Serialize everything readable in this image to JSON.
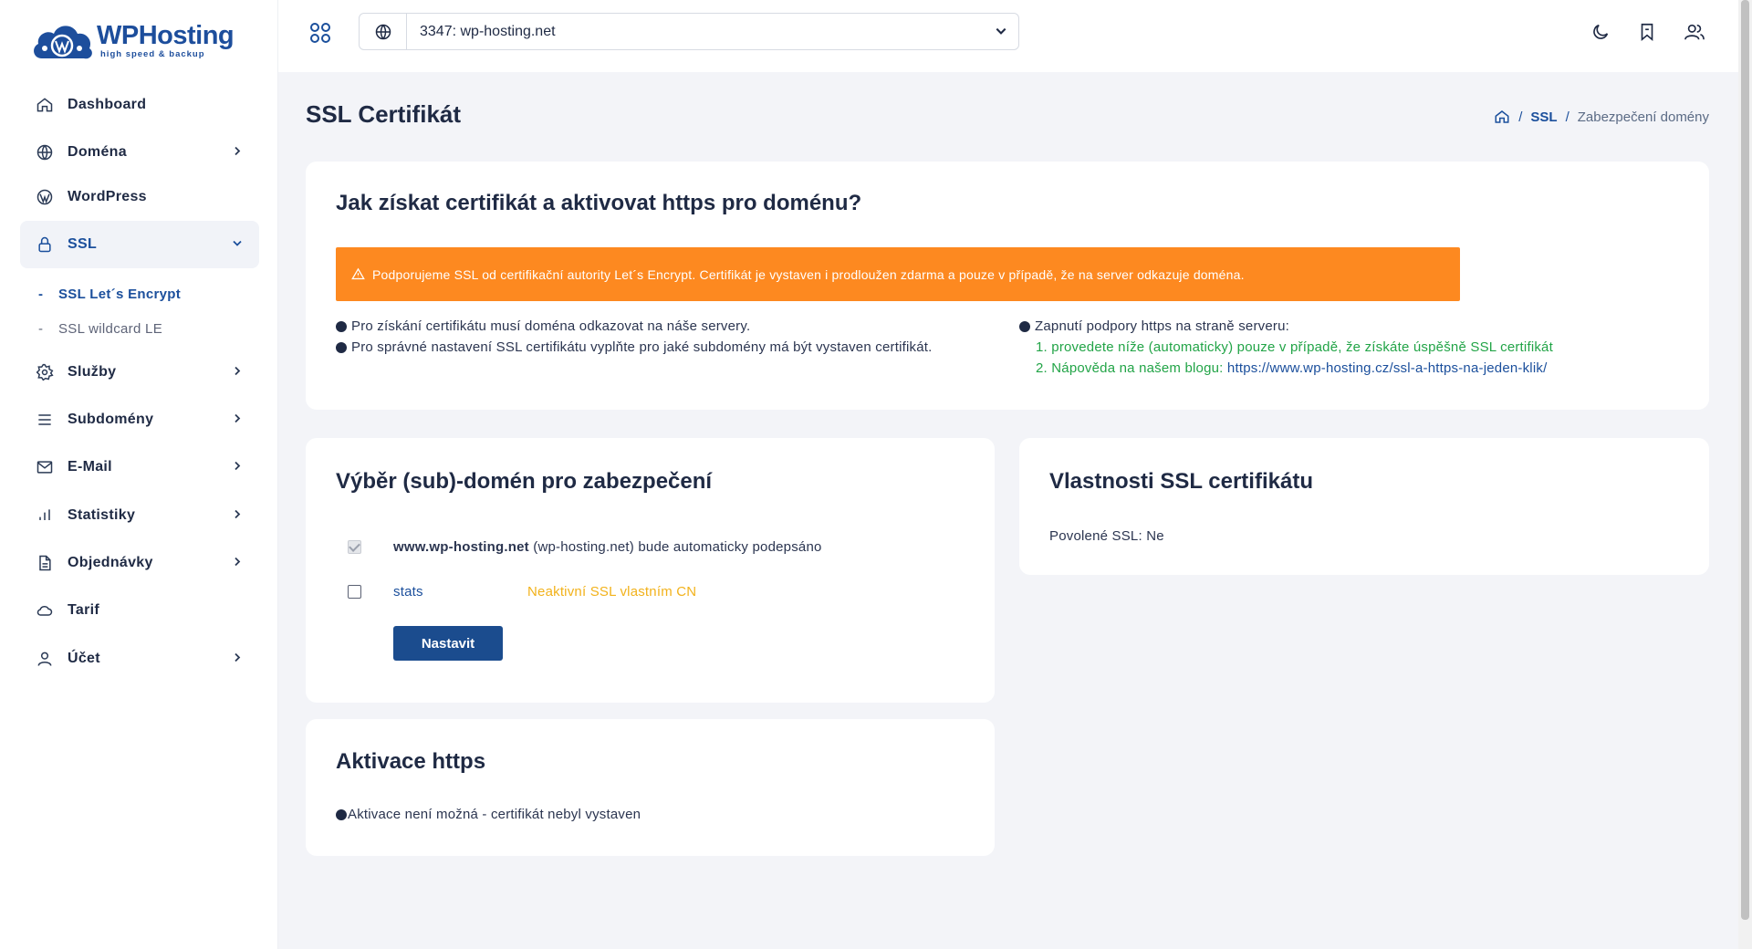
{
  "brand": {
    "name": "WPHosting",
    "tagline": "high speed & backup"
  },
  "sidebar": {
    "items": [
      {
        "label": "Dashboard",
        "icon": "home-icon"
      },
      {
        "label": "Doména",
        "icon": "globe-icon"
      },
      {
        "label": "WordPress",
        "icon": "wordpress-icon"
      },
      {
        "label": "SSL",
        "icon": "lock-icon"
      },
      {
        "label": "Služby",
        "icon": "gear-icon"
      },
      {
        "label": "Subdomény",
        "icon": "menu-lines-icon"
      },
      {
        "label": "E-Mail",
        "icon": "mail-icon"
      },
      {
        "label": "Statistiky",
        "icon": "bar-chart-icon"
      },
      {
        "label": "Objednávky",
        "icon": "document-icon"
      },
      {
        "label": "Tarif",
        "icon": "cloud-icon"
      },
      {
        "label": "Účet",
        "icon": "user-icon"
      }
    ],
    "ssl_sub": [
      {
        "label": "SSL Let´s Encrypt"
      },
      {
        "label": "SSL wildcard LE"
      }
    ]
  },
  "topbar": {
    "domain_value": "3347: wp-hosting.net"
  },
  "page": {
    "title": "SSL Certifikát",
    "breadcrumb": {
      "sep": "/",
      "link": "SSL",
      "current": "Zabezpečení domény"
    }
  },
  "howto": {
    "title": "Jak získat certifikát a aktivovat https pro doménu?",
    "alert": "Podporujeme SSL od certifikační autority Let´s Encrypt. Certifikát je vystaven i prodloužen zdarma a pouze v případě, že na server odkazuje doména.",
    "left_bullets": [
      "Pro získání certifikátu musí doména odkazovat na náše servery.",
      "Pro správné nastavení SSL certifikátu vyplňte pro jaké subdomény má být vystaven certifikát."
    ],
    "right_bullet": "Zapnutí podpory https na straně serveru:",
    "step1": "1. provedete níže (automaticky) pouze v případě, že získáte úspěšně SSL certifikát",
    "step2_prefix": "2. Nápověda na našem blogu: ",
    "step2_link": "https://www.wp-hosting.cz/ssl-a-https-na-jeden-klik/"
  },
  "select_domains": {
    "title": "Výběr (sub)-domén pro zabezpečení",
    "row1_domain": "www.wp-hosting.net",
    "row1_rest": " (wp-hosting.net) bude automaticky podepsáno",
    "row2_name": "stats",
    "row2_status": "Neaktivní SSL vlastním CN",
    "button": "Nastavit"
  },
  "properties": {
    "title": "Vlastnosti SSL certifikátu",
    "allowed": "Povolené SSL: Ne"
  },
  "https_activation": {
    "title": "Aktivace https",
    "text": "Aktivace není možná - certifikát nebyl vystaven"
  },
  "colors": {
    "accent": "#1b4f9c",
    "alert": "#fd8920",
    "success": "#22a447",
    "warning_text": "#f2b21b"
  }
}
